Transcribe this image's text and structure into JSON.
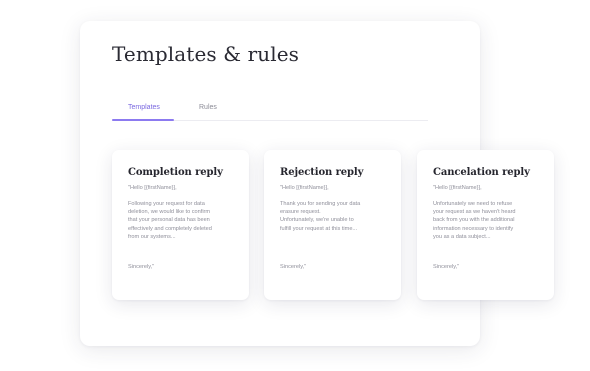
{
  "page": {
    "title": "Templates & rules"
  },
  "tabs": [
    {
      "label": "Templates",
      "active": true
    },
    {
      "label": "Rules",
      "active": false
    }
  ],
  "colors": {
    "accent": "#8c7af0",
    "background": "#ffffff",
    "muted_text": "#8f8f9a"
  },
  "cards": [
    {
      "title": "Completion reply",
      "greeting": "\"Hello [{firstName}],",
      "body_lines": [
        "Following your request for data",
        "deletion, we would like to confirm",
        "that your personal data has been",
        "effectively and completely deleted",
        "from our systems..."
      ],
      "signoff": "Sincerely,\""
    },
    {
      "title": "Rejection reply",
      "greeting": "\"Hello [{firstName}],",
      "body_lines": [
        "Thank you for sending your data",
        "erasure request.",
        "Unfortunately, we're unable to",
        "fulfill your request at this time..."
      ],
      "signoff": "Sincerely,\""
    },
    {
      "title": "Cancelation reply",
      "greeting": "\"Hello [{firstName}],",
      "body_lines": [
        "Unfortunately we need to refuse",
        "your request as we haven't heard",
        "back from you with the additional",
        "information necessary to identify",
        "you as a data subject..."
      ],
      "signoff": "Sincerely,\""
    }
  ]
}
